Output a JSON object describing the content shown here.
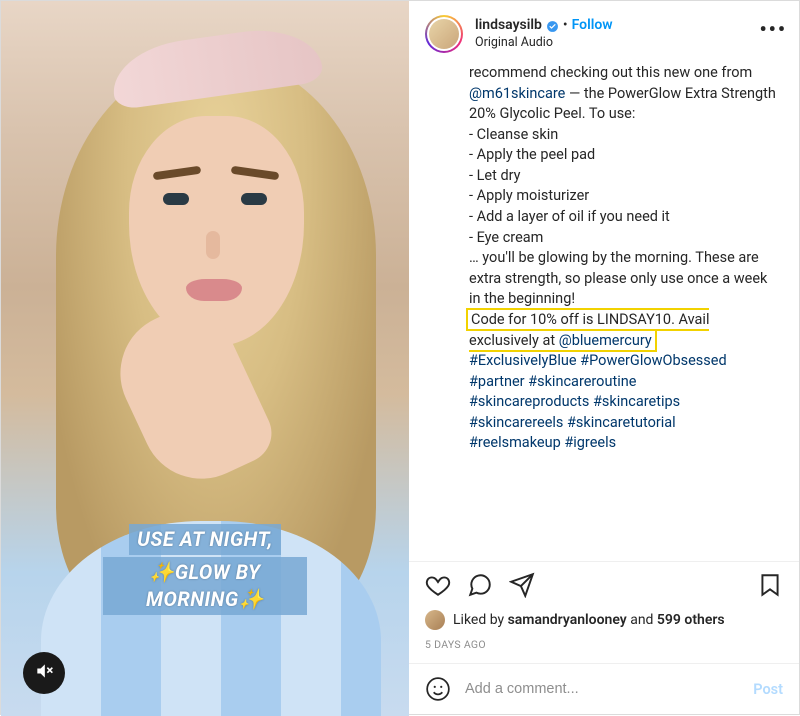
{
  "header": {
    "username": "lindsaysilb",
    "follow_label": "Follow",
    "audio_label": "Original Audio",
    "dot": "•"
  },
  "overlay": {
    "line1": "USE AT NIGHT,",
    "line2": "✨GLOW BY MORNING✨"
  },
  "caption": {
    "line_intro": "recommend checking out this new one from ",
    "mention1": "@m61skincare",
    "after_mention1": " — the PowerGlow Extra Strength 20% Glycolic Peel. To use:",
    "step1": "- Cleanse skin",
    "step2": "- Apply the peel pad",
    "step3": "- Let dry",
    "step4": "- Apply moisturizer",
    "step5": "- Add a layer of oil if you need it",
    "step6": "- Eye cream",
    "outro1": "… you'll be glowing by the morning. These are extra strength, so please only use once a week in the beginning!",
    "hl_part1": "Code for 10% off is LINDSAY10. Avail exclusively at ",
    "hl_mention": "@bluemercury",
    "hashline1": "#ExclusivelyBlue #PowerGlowObsessed",
    "hashline2": "#partner #skincareroutine",
    "hashline3": "#skincareproducts #skincaretips",
    "hashline4": "#skincarereels #skincaretutorial",
    "hashline5": "#reelsmakeup #igreels"
  },
  "likes": {
    "prefix": "Liked by ",
    "name": "samandryanlooney",
    "mid": " and ",
    "count": "599 others"
  },
  "timestamp": "5 DAYS AGO",
  "comment": {
    "placeholder": "Add a comment...",
    "post_label": "Post"
  }
}
